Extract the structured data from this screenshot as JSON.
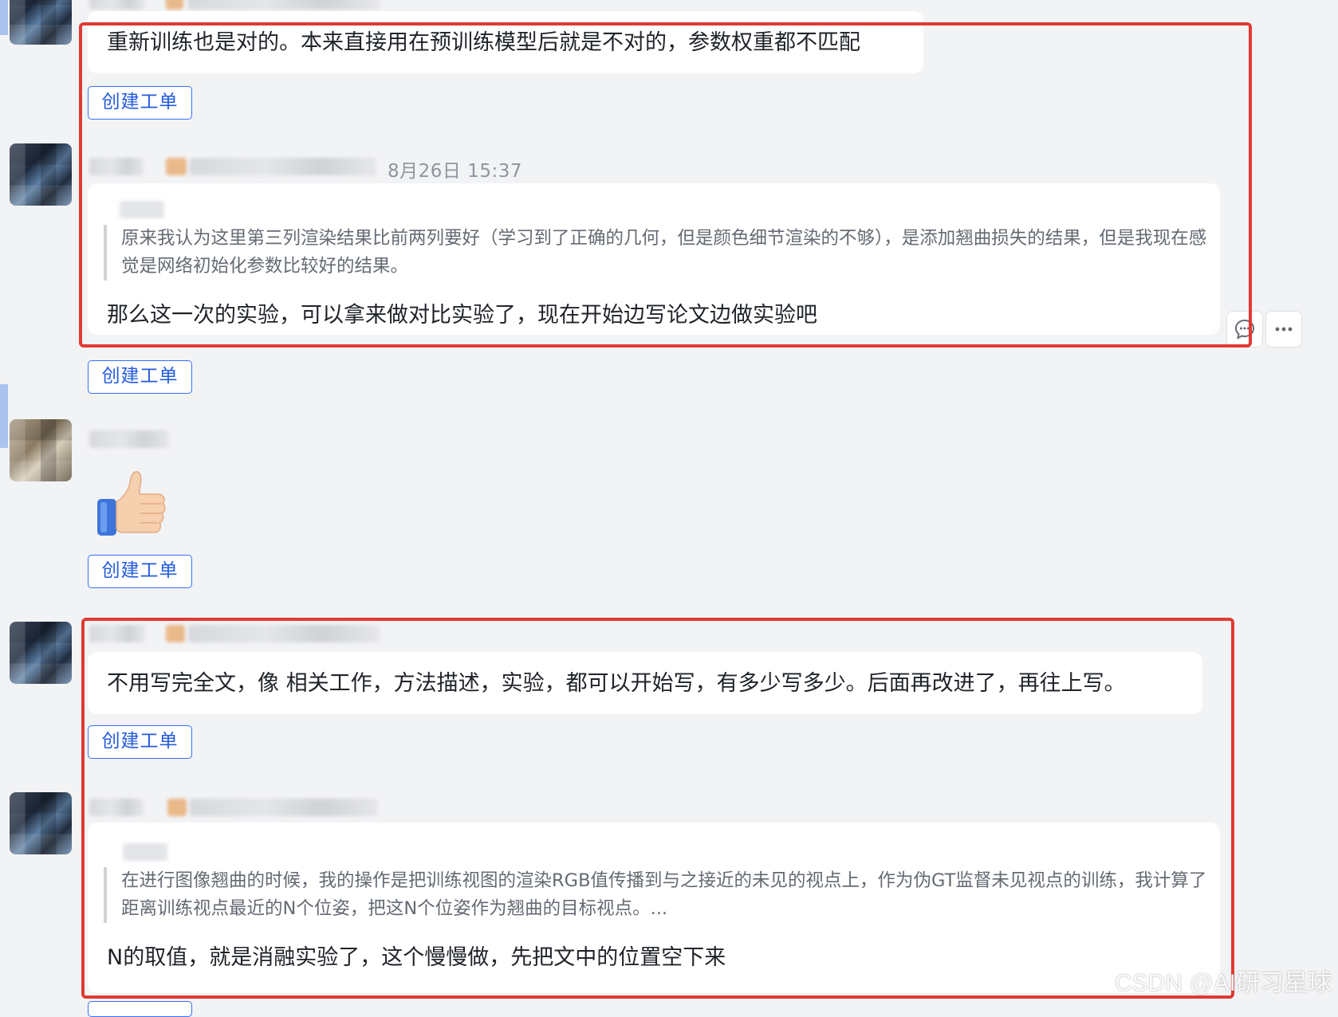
{
  "messages": [
    {
      "id": "m1",
      "text": "重新训练也是对的。本来直接用在预训练模型后就是不对的，参数权重都不匹配",
      "action": "创建工单"
    },
    {
      "id": "m2",
      "timestamp": "8月26日 15:37",
      "quote": "原来我认为这里第三列渲染结果比前两列要好（学习到了正确的几何，但是颜色细节渲染的不够），是添加翘曲损失的结果，但是我现在感觉是网络初始化参数比较好的结果。",
      "text": "那么这一次的实验，可以拿来做对比实验了，现在开始边写论文边做实验吧",
      "action": "创建工单"
    },
    {
      "id": "m3",
      "emoji": "👍",
      "action": "创建工单"
    },
    {
      "id": "m4",
      "text": "不用写完全文，像 相关工作，方法描述，实验，都可以开始写，有多少写多少。后面再改进了，再往上写。",
      "action": "创建工单"
    },
    {
      "id": "m5",
      "quote": "在进行图像翘曲的时候，我的操作是把训练视图的渲染RGB值传播到与之接近的未见的视点上，作为伪GT监督未见视点的训练，我计算了距离训练视点最近的N个位姿，把这N个位姿作为翘曲的目标视点。...",
      "text": "N的取值，就是消融实验了，这个慢慢做，先把文中的位置空下来"
    }
  ],
  "hover_actions": {
    "reply_icon": "comment-icon",
    "more_icon": "more-icon"
  },
  "watermark": "CSDN @AI研习星球",
  "colors": {
    "highlight": "#e03a33",
    "link": "#245bdb",
    "background": "#f2f3f5"
  }
}
